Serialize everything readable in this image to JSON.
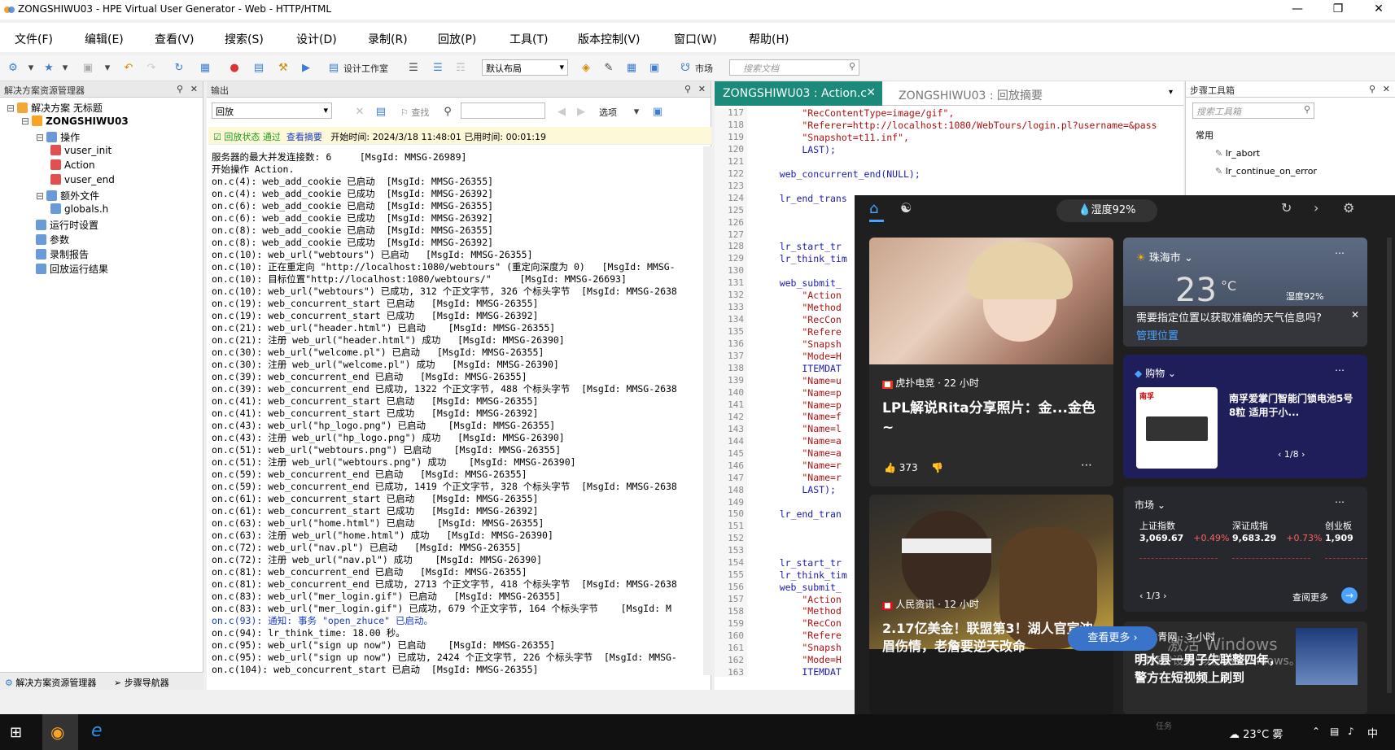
{
  "window": {
    "title": "ZONGSHIWU03 - HPE Virtual User Generator - Web - HTTP/HTML"
  },
  "menu": [
    "文件(F)",
    "编辑(E)",
    "查看(V)",
    "搜索(S)",
    "设计(D)",
    "录制(R)",
    "回放(P)",
    "工具(T)",
    "版本控制(V)",
    "窗口(W)",
    "帮助(H)"
  ],
  "toolbar": {
    "design_studio": "设计工作室",
    "layout": "默认布局",
    "market": "市场",
    "search_placeholder": "搜索文档"
  },
  "left_panel": {
    "title": "解决方案资源管理器",
    "tree": [
      {
        "label": "解决方案 无标题",
        "level": 0
      },
      {
        "label": "ZONGSHIWU03",
        "level": 1
      },
      {
        "label": "操作",
        "level": 2
      },
      {
        "label": "vuser_init",
        "level": 3
      },
      {
        "label": "Action",
        "level": 3
      },
      {
        "label": "vuser_end",
        "level": 3
      },
      {
        "label": "额外文件",
        "level": 2
      },
      {
        "label": "globals.h",
        "level": 3
      },
      {
        "label": "运行时设置",
        "level": 2
      },
      {
        "label": "参数",
        "level": 2
      },
      {
        "label": "录制报告",
        "level": 2
      },
      {
        "label": "回放运行结果",
        "level": 2
      }
    ],
    "tabs": [
      "解决方案资源管理器",
      "步骤导航器"
    ]
  },
  "output_panel": {
    "title": "输出",
    "source": "回放",
    "find_label": "查找",
    "options_label": "选项",
    "status_label": "回放状态 通过",
    "view_summary": "查看摘要",
    "timing": "开始时间: 2024/3/18 11:48:01 已用时间: 00:01:19",
    "lines": [
      {
        "t": "服务器的最大并发连接数: 6     [MsgId: MMSG-26989]"
      },
      {
        "t": "开始操作 Action."
      },
      {
        "t": "on.c(4): web_add_cookie 已启动  [MsgId: MMSG-26355]"
      },
      {
        "t": "on.c(4): web_add_cookie 已成功  [MsgId: MMSG-26392]"
      },
      {
        "t": "on.c(6): web_add_cookie 已启动  [MsgId: MMSG-26355]"
      },
      {
        "t": "on.c(6): web_add_cookie 已成功  [MsgId: MMSG-26392]"
      },
      {
        "t": "on.c(8): web_add_cookie 已启动  [MsgId: MMSG-26355]"
      },
      {
        "t": "on.c(8): web_add_cookie 已成功  [MsgId: MMSG-26392]"
      },
      {
        "t": "on.c(10): web_url(\"webtours\") 已启动   [MsgId: MMSG-26355]"
      },
      {
        "t": "on.c(10): 正在重定向 \"http://localhost:1080/webtours\" (重定向深度为 0)   [MsgId: MMSG-"
      },
      {
        "t": "on.c(10): 目标位置\"http://localhost:1080/webtours/\"     [MsgId: MMSG-26693]"
      },
      {
        "t": "on.c(10): web_url(\"webtours\") 已成功, 312 个正文字节, 326 个标头字节  [MsgId: MMSG-2638"
      },
      {
        "t": "on.c(19): web_concurrent_start 已启动   [MsgId: MMSG-26355]"
      },
      {
        "t": "on.c(19): web_concurrent_start 已成功   [MsgId: MMSG-26392]"
      },
      {
        "t": "on.c(21): web_url(\"header.html\") 已启动    [MsgId: MMSG-26355]"
      },
      {
        "t": "on.c(21): 注册 web_url(\"header.html\") 成功   [MsgId: MMSG-26390]"
      },
      {
        "t": "on.c(30): web_url(\"welcome.pl\") 已启动   [MsgId: MMSG-26355]"
      },
      {
        "t": "on.c(30): 注册 web_url(\"welcome.pl\") 成功   [MsgId: MMSG-26390]"
      },
      {
        "t": "on.c(39): web_concurrent_end 已启动   [MsgId: MMSG-26355]"
      },
      {
        "t": "on.c(39): web_concurrent_end 已成功, 1322 个正文字节, 488 个标头字节  [MsgId: MMSG-2638"
      },
      {
        "t": "on.c(41): web_concurrent_start 已启动   [MsgId: MMSG-26355]"
      },
      {
        "t": "on.c(41): web_concurrent_start 已成功   [MsgId: MMSG-26392]"
      },
      {
        "t": "on.c(43): web_url(\"hp_logo.png\") 已启动    [MsgId: MMSG-26355]"
      },
      {
        "t": "on.c(43): 注册 web_url(\"hp_logo.png\") 成功   [MsgId: MMSG-26390]"
      },
      {
        "t": "on.c(51): web_url(\"webtours.png\") 已启动    [MsgId: MMSG-26355]"
      },
      {
        "t": "on.c(51): 注册 web_url(\"webtours.png\") 成功    [MsgId: MMSG-26390]"
      },
      {
        "t": "on.c(59): web_concurrent_end 已启动   [MsgId: MMSG-26355]"
      },
      {
        "t": "on.c(59): web_concurrent_end 已成功, 1419 个正文字节, 328 个标头字节  [MsgId: MMSG-2638"
      },
      {
        "t": "on.c(61): web_concurrent_start 已启动   [MsgId: MMSG-26355]"
      },
      {
        "t": "on.c(61): web_concurrent_start 已成功   [MsgId: MMSG-26392]"
      },
      {
        "t": "on.c(63): web_url(\"home.html\") 已启动    [MsgId: MMSG-26355]"
      },
      {
        "t": "on.c(63): 注册 web_url(\"home.html\") 成功   [MsgId: MMSG-26390]"
      },
      {
        "t": "on.c(72): web_url(\"nav.pl\") 已启动   [MsgId: MMSG-26355]"
      },
      {
        "t": "on.c(72): 注册 web_url(\"nav.pl\") 成功    [MsgId: MMSG-26390]"
      },
      {
        "t": "on.c(81): web_concurrent_end 已启动   [MsgId: MMSG-26355]"
      },
      {
        "t": "on.c(81): web_concurrent_end 已成功, 2713 个正文字节, 418 个标头字节  [MsgId: MMSG-2638"
      },
      {
        "t": "on.c(83): web_url(\"mer_login.gif\") 已启动   [MsgId: MMSG-26355]"
      },
      {
        "t": "on.c(83): web_url(\"mer_login.gif\") 已成功, 679 个正文字节, 164 个标头字节    [MsgId: M"
      },
      {
        "t": "on.c(93): 通知: 事务 \"open_zhuce\" 已启动。",
        "blue": true
      },
      {
        "t": "on.c(94): lr_think_time: 18.00 秒。"
      },
      {
        "t": "on.c(95): web_url(\"sign up now\") 已启动    [MsgId: MMSG-26355]"
      },
      {
        "t": "on.c(95): web_url(\"sign up now\") 已成功, 2424 个正文字节, 226 个标头字节  [MsgId: MMSG-"
      },
      {
        "t": "on.c(104): web_concurrent_start 已启动  [MsgId: MMSG-26355]"
      }
    ]
  },
  "code_panel": {
    "tab_active": "ZONGSHIWU03 : Action.c",
    "tab_inactive": "ZONGSHIWU03 : 回放摘要",
    "line_numbers": [
      "117",
      "118",
      "119",
      "120",
      "121",
      "122",
      "123",
      "124",
      "125",
      "126",
      "127",
      "128",
      "129",
      "130",
      "131",
      "132",
      "133",
      "134",
      "135",
      "136",
      "137",
      "138",
      "139",
      "140",
      "141",
      "142",
      "143",
      "144",
      "145",
      "146",
      "147",
      "148",
      "149",
      "150",
      "151",
      "152",
      "153",
      "154",
      "155",
      "156",
      "157",
      "158",
      "159",
      "160",
      "161",
      "162",
      "163"
    ],
    "lines": [
      "        \"RecContentType=image/gif\",",
      "        \"Referer=http://localhost:1080/WebTours/login.pl?username=&pass",
      "        \"Snapshot=t11.inf\",",
      "        LAST);",
      "",
      "    web_concurrent_end(NULL);",
      "",
      "    lr_end_trans",
      "",
      "",
      "",
      "    lr_start_tr",
      "    lr_think_tim",
      "",
      "    web_submit_",
      "        \"Action",
      "        \"Method",
      "        \"RecCon",
      "        \"Refere",
      "        \"Snapsh",
      "        \"Mode=H",
      "        ITEMDAT",
      "        \"Name=u",
      "        \"Name=p",
      "        \"Name=p",
      "        \"Name=f",
      "        \"Name=l",
      "        \"Name=a",
      "        \"Name=a",
      "        \"Name=r",
      "        \"Name=r",
      "        LAST);",
      "",
      "    lr_end_tran",
      "",
      "",
      "",
      "    lr_start_tr",
      "    lr_think_tim",
      "    web_submit_",
      "        \"Action",
      "        \"Method",
      "        \"RecCon",
      "        \"Refere",
      "        \"Snapsh",
      "        \"Mode=H",
      "        ITEMDAT"
    ]
  },
  "step_toolbox": {
    "title": "步骤工具箱",
    "search_placeholder": "搜索工具箱",
    "group": "常用",
    "items": [
      "lr_abort",
      "lr_continue_on_error"
    ]
  },
  "widget": {
    "humidity": "湿度92%",
    "news1": {
      "source": "虎扑电竞 · 22 小时",
      "headline": "LPL解说Rita分享照片：金...金色~",
      "likes": "373"
    },
    "weather": {
      "city": "珠海市",
      "temp": "23",
      "unit": "°C",
      "humidity": "湿度92%",
      "prompt": "需要指定位置以获取准确的天气信息吗?",
      "manage": "管理位置"
    },
    "shopping": {
      "label": "购物",
      "product": "南孚爱掌门智能门锁电池5号8粒 适用于小...",
      "pager": "1/8",
      "brand": "南孚"
    },
    "market": {
      "label": "市场",
      "items": [
        {
          "name": "上证指数",
          "value": "3,069.67",
          "change": "+0.49%"
        },
        {
          "name": "深证成指",
          "value": "9,683.29",
          "change": "+0.73%"
        },
        {
          "name": "创业板",
          "value": "1,909",
          "change": ""
        }
      ],
      "pager": "1/3",
      "more": "查阅更多"
    },
    "news2": {
      "source": "人民资讯 · 12 小时",
      "headline": "2.17亿美金！联盟第3！湖人官宣浓眉伤情，老詹要逆天改命"
    },
    "news3": {
      "source": "北青网 · 3 小时",
      "headline": "明水县一男子失联整四年，警方在短视频上刷到"
    },
    "see_more": "查看更多",
    "activate1": "激活 Windows",
    "activate2": "转到\"设置\"以激活 Windows。"
  },
  "taskbar": {
    "weather": "23°C 雾",
    "ime": "中",
    "task_label": "任务"
  }
}
